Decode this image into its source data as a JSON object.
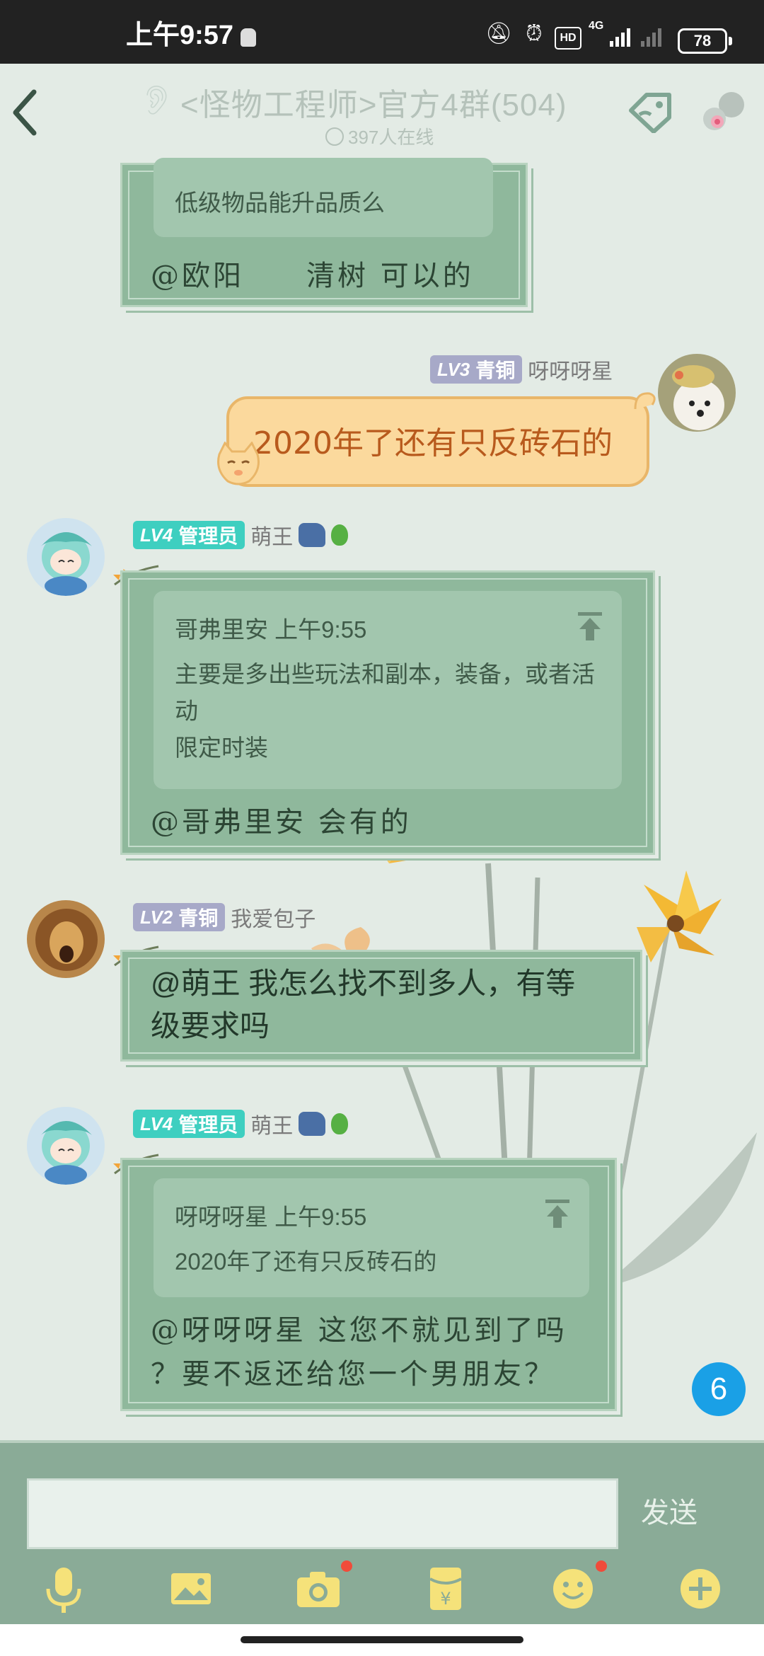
{
  "status_bar": {
    "time": "上午9:57",
    "battery": "78",
    "network": "4G",
    "hd": "HD",
    "icons": [
      "mute-bell-icon",
      "alarm-icon",
      "hd-icon",
      "signal-icon",
      "battery-icon"
    ]
  },
  "header": {
    "title": "<怪物工程师>官方4群(504)",
    "online": "397人在线",
    "icons": [
      "back-arrow-icon",
      "ear-icon",
      "tag-icon",
      "group-avatar-icon"
    ]
  },
  "messages": [
    {
      "partial": true,
      "quote_body": "低级物品能升品质么",
      "reply": "@欧阳　　清树 可以的"
    },
    {
      "sender": "呀呀呀星",
      "badge_level": "LV3",
      "badge_title": "青铜",
      "text": "2020年了还有只反砖石的",
      "side": "right"
    },
    {
      "sender": "萌王",
      "badge_level": "LV4",
      "badge_title": "管理员",
      "quote_header": "哥弗里安 上午9:55",
      "quote_lines": [
        "主要是多出些玩法和副本，装备，或者活",
        "动",
        "限定时装"
      ],
      "reply": "@哥弗里安 会有的"
    },
    {
      "sender": "我爱包子",
      "badge_level": "LV2",
      "badge_title": "青铜",
      "text_lines": [
        "@萌王 我怎么找不到多人，有等",
        "级要求吗"
      ]
    },
    {
      "sender": "萌王",
      "badge_level": "LV4",
      "badge_title": "管理员",
      "quote_header": "呀呀呀星 上午9:55",
      "quote_lines": [
        "2020年了还有只反砖石的"
      ],
      "reply_lines": [
        "@呀呀呀星 这您不就见到了吗",
        "？要不返还给您一个男朋友？"
      ]
    }
  ],
  "unread_count": "6",
  "input": {
    "placeholder": "",
    "send_label": "发送"
  },
  "toolbar_icons": [
    "mic-icon",
    "image-icon",
    "camera-icon",
    "red-packet-icon",
    "emoji-icon",
    "plus-icon"
  ],
  "colors": {
    "bubble": "#8fb89c",
    "admin_badge": "#3ecfc0",
    "bronze_badge": "#a7a9c8",
    "unread": "#1aa0e6",
    "toolbar_bg": "#8aab97"
  }
}
